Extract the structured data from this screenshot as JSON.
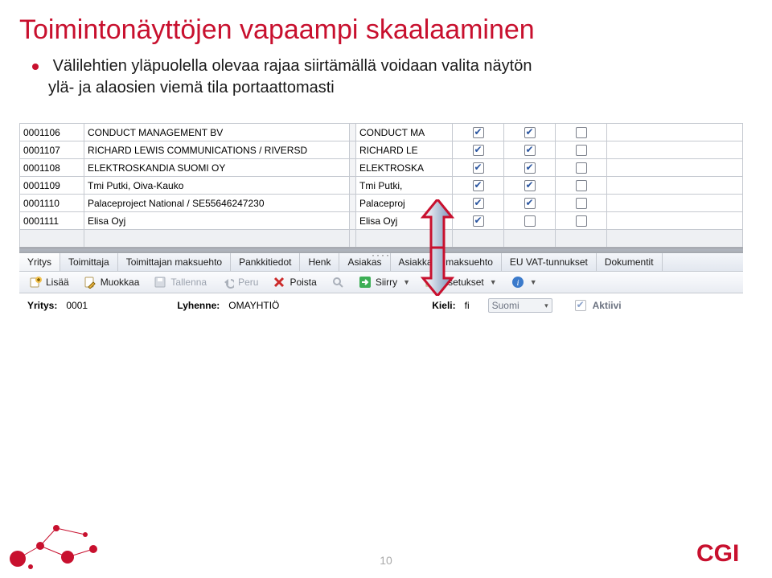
{
  "slide": {
    "title": "Toimintonäyttöjen vapaampi skaalaaminen",
    "bullet_line1": "Välilehtien yläpuolella olevaa rajaa siirtämällä voidaan valita näytön",
    "bullet_line2": "ylä- ja alaosien viemä tila portaattomasti",
    "page_number": "10",
    "logo_text": "CGI"
  },
  "grid": {
    "rows": [
      {
        "code": "0001106",
        "name": "CONDUCT MANAGEMENT BV",
        "abbr": "CONDUCT MA",
        "c1": true,
        "c2": true,
        "c3": false
      },
      {
        "code": "0001107",
        "name": "RICHARD LEWIS COMMUNICATIONS / RIVERSD",
        "abbr": "RICHARD LE",
        "c1": true,
        "c2": true,
        "c3": false
      },
      {
        "code": "0001108",
        "name": "ELEKTROSKANDIA SUOMI OY",
        "abbr": "ELEKTROSKA",
        "c1": true,
        "c2": true,
        "c3": false
      },
      {
        "code": "0001109",
        "name": "Tmi Putki, Oiva-Kauko",
        "abbr": "Tmi Putki,",
        "c1": true,
        "c2": true,
        "c3": false
      },
      {
        "code": "0001110",
        "name": "Palaceproject National / SE55646247230",
        "abbr": "Palaceproj",
        "c1": true,
        "c2": true,
        "c3": false
      },
      {
        "code": "0001111",
        "name": "Elisa Oyj",
        "abbr": "Elisa Oyj",
        "c1": true,
        "c2": false,
        "c3": false
      }
    ]
  },
  "tabs": {
    "items": [
      {
        "label": "Yritys",
        "active": true
      },
      {
        "label": "Toimittaja",
        "active": false
      },
      {
        "label": "Toimittajan maksuehto",
        "active": false
      },
      {
        "label": "Pankkitiedot",
        "active": false
      },
      {
        "label": "Henk",
        "active": false
      },
      {
        "label": "Asiakas",
        "active": false
      },
      {
        "label": "Asiakkaan maksuehto",
        "active": false
      },
      {
        "label": "EU VAT-tunnukset",
        "active": false
      },
      {
        "label": "Dokumentit",
        "active": false
      }
    ]
  },
  "toolbar": {
    "add": {
      "label": "Lisää",
      "icon": "add-icon"
    },
    "edit": {
      "label": "Muokkaa",
      "icon": "edit-icon"
    },
    "save": {
      "label": "Tallenna",
      "icon": "save-icon"
    },
    "undo": {
      "label": "Peru",
      "icon": "undo-icon"
    },
    "delete": {
      "label": "Poista",
      "icon": "delete-icon"
    },
    "goto": {
      "label": "Siirry",
      "icon": "goto-icon"
    },
    "settings": {
      "label": "Asetukset",
      "icon": "settings-icon"
    },
    "info": {
      "label": "",
      "icon": "info-icon"
    }
  },
  "form": {
    "yritys_label": "Yritys:",
    "yritys_value": "0001",
    "lyhenne_label": "Lyhenne:",
    "lyhenne_value": "OMAYHTIÖ",
    "kieli_label": "Kieli:",
    "kieli_code": "fi",
    "kieli_name": "Suomi",
    "aktiivi_label": "Aktiivi"
  }
}
